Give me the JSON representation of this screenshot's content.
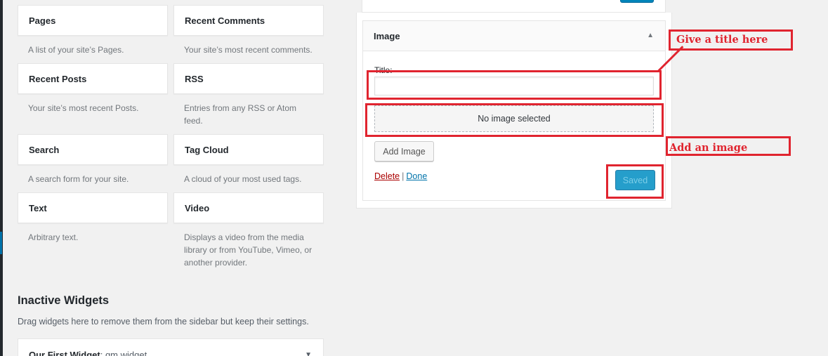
{
  "available_widgets": [
    {
      "name": "Pages",
      "description": "A list of your site’s Pages."
    },
    {
      "name": "Recent Comments",
      "description": "Your site’s most recent comments."
    },
    {
      "name": "Recent Posts",
      "description": "Your site’s most recent Posts."
    },
    {
      "name": "RSS",
      "description": "Entries from any RSS or Atom feed."
    },
    {
      "name": "Search",
      "description": "A search form for your site."
    },
    {
      "name": "Tag Cloud",
      "description": "A cloud of your most used tags."
    },
    {
      "name": "Text",
      "description": "Arbitrary text."
    },
    {
      "name": "Video",
      "description": "Displays a video from the media library or from YouTube, Vimeo, or another provider."
    }
  ],
  "inactive": {
    "title": "Inactive Widgets",
    "description": "Drag widgets here to remove them from the sidebar but keep their settings.",
    "widget_name": "Our First Widget",
    "widget_sub": ": gm widget"
  },
  "image_widget": {
    "title": "Image",
    "title_label": "Title:",
    "title_value": "",
    "no_image_text": "No image selected",
    "add_image_label": "Add Image",
    "delete_label": "Delete",
    "separator": "|",
    "done_label": "Done",
    "saved_label": "Saved"
  },
  "annotations": {
    "title_hint": "Give a title here",
    "image_hint": "Add an image",
    "color": "#e0242f"
  },
  "icons": {
    "collapse": "▲",
    "expand": "▼"
  }
}
